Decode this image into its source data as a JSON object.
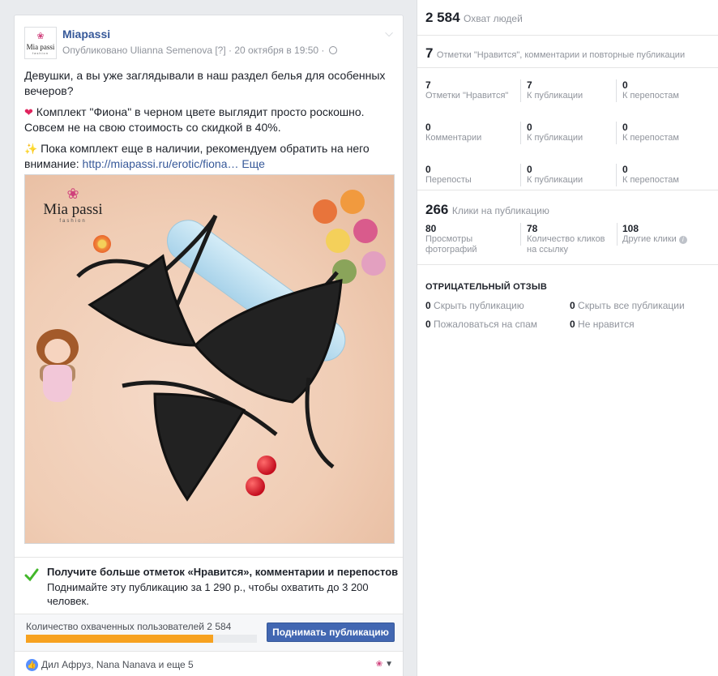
{
  "post": {
    "page_name": "Miapassi",
    "meta": "Опубликовано Ulianna Semenova [?] · 20 октября в 19:50 ·",
    "avatar_brand": "Mia passi",
    "avatar_sub": "fashion",
    "paragraphs": {
      "p1": "Девушки, а вы уже заглядывали в наш раздел белья для особенных вечеров?",
      "p2": " Комплект \"Фиона\" в черном цвете выглядит просто роскошно. Совсем не на свою стоимость со скидкой в 40%.",
      "p3": " Пока комплект еще в наличии, рекомендуем обратить на него внимание: ",
      "link": "http://miapassi.ru/erotic/fiona…",
      "more": "Еще"
    },
    "photo_brand": "Mia passi",
    "photo_sub": "fashion"
  },
  "promote": {
    "title": "Получите больше отметок «Нравится», комментарии и перепостов",
    "text": "Поднимайте эту публикацию за 1 290 р., чтобы охватить до 3 200 человек."
  },
  "boost": {
    "reach_label": "Количество охваченных пользователей 2 584",
    "reach_fraction": 0.81,
    "button_label": "Поднимать публикацию"
  },
  "reactions": {
    "names": "Дил Афруз, Nana Nanava и еще 5"
  },
  "stats": {
    "reach": {
      "value": "2 584",
      "label": "Охват людей"
    },
    "engagement": {
      "value": "7",
      "label": "Отметки \"Нравится\", комментарии и повторные публикации"
    },
    "likes": [
      {
        "n": "7",
        "l": "Отметки \"Нравится\""
      },
      {
        "n": "7",
        "l": "К публикации"
      },
      {
        "n": "0",
        "l": "К перепостам"
      }
    ],
    "comments": [
      {
        "n": "0",
        "l": "Комментарии"
      },
      {
        "n": "0",
        "l": "К публикации"
      },
      {
        "n": "0",
        "l": "К перепостам"
      }
    ],
    "shares": [
      {
        "n": "0",
        "l": "Перепосты"
      },
      {
        "n": "0",
        "l": "К публикации"
      },
      {
        "n": "0",
        "l": "К перепостам"
      }
    ],
    "clicks": {
      "value": "266",
      "label": "Клики на публикацию"
    },
    "click_breakdown": [
      {
        "n": "80",
        "l1": "Просмотры",
        "l2": "фотографий"
      },
      {
        "n": "78",
        "l1": "Количество кликов",
        "l2": "на ссылку"
      },
      {
        "n": "108",
        "l1": "Другие клики",
        "l2": ""
      }
    ],
    "negative": {
      "title": "ОТРИЦАТЕЛЬНЫЙ ОТЗЫВ",
      "hide_post": {
        "n": "0",
        "l": "Скрыть публикацию"
      },
      "hide_all": {
        "n": "0",
        "l": "Скрыть все публикации"
      },
      "spam": {
        "n": "0",
        "l": "Пожаловаться на спам"
      },
      "unlike": {
        "n": "0",
        "l": "Не нравится"
      }
    }
  }
}
